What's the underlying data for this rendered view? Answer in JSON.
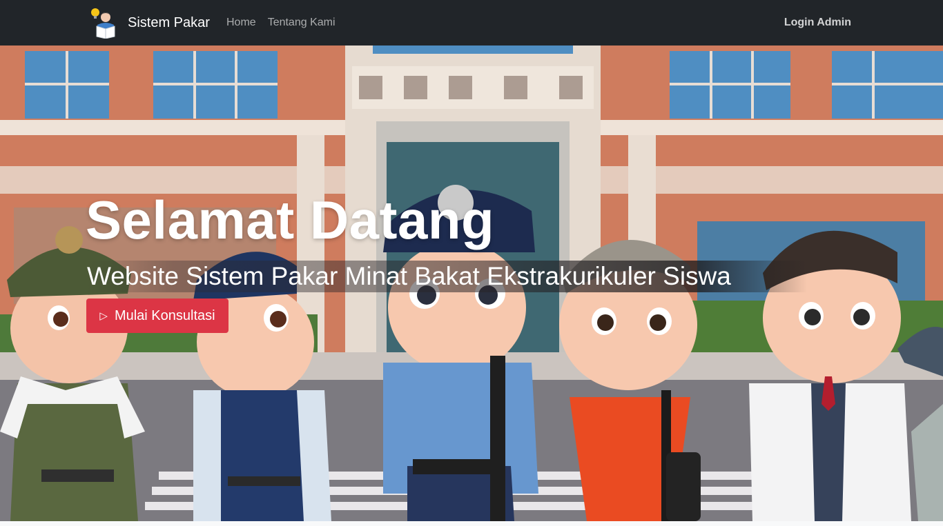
{
  "navbar": {
    "brand": "Sistem Pakar",
    "brand_logo_icon": "reading-student-icon",
    "links": [
      {
        "label": "Home"
      },
      {
        "label": "Tentang Kami"
      }
    ],
    "login_label": "Login Admin",
    "background": "#212529"
  },
  "hero": {
    "title": "Selamat Datang",
    "subtitle": "Website Sistem Pakar Minat Bakat Ekstrakurikuler Siswa",
    "cta_label": "Mulai Konsultasi",
    "cta_icon": "play-outline-icon",
    "cta_color": "#dc3545",
    "background_image": "cartoon-children-in-uniforms-in-front-of-school"
  }
}
